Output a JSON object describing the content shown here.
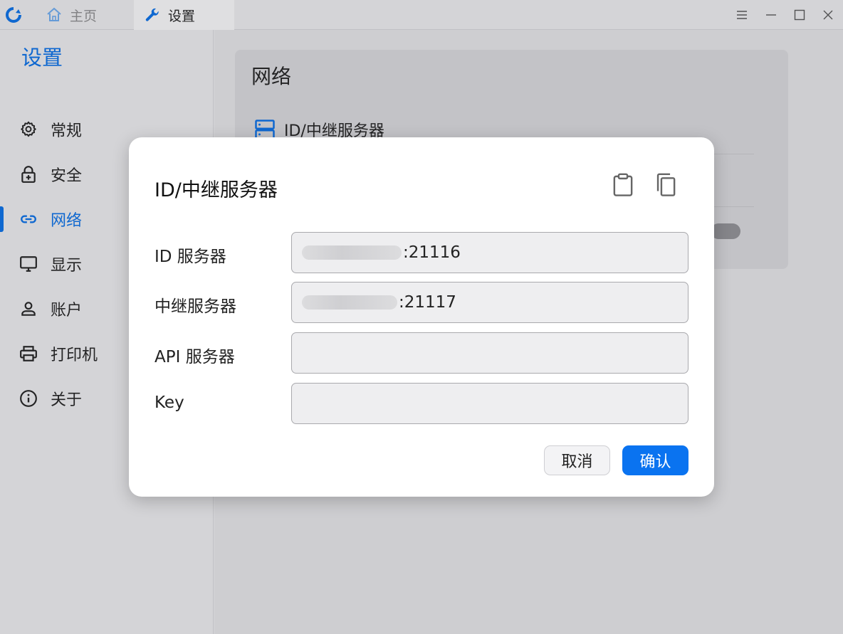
{
  "titlebar": {
    "tabs": [
      {
        "label": "主页",
        "icon": "home-icon"
      },
      {
        "label": "设置",
        "icon": "wrench-icon"
      }
    ],
    "controls": [
      "menu-icon",
      "minimize-icon",
      "maximize-icon",
      "close-icon"
    ]
  },
  "sidebar": {
    "title": "设置",
    "items": [
      {
        "label": "常规",
        "icon": "gear-icon"
      },
      {
        "label": "安全",
        "icon": "lock-icon"
      },
      {
        "label": "网络",
        "icon": "link-icon",
        "active": true
      },
      {
        "label": "显示",
        "icon": "monitor-icon"
      },
      {
        "label": "账户",
        "icon": "person-icon"
      },
      {
        "label": "打印机",
        "icon": "printer-icon"
      },
      {
        "label": "关于",
        "icon": "info-icon"
      }
    ]
  },
  "main": {
    "card": {
      "title": "网络",
      "rows": [
        {
          "label": "ID/中继服务器",
          "icon": "server-icon"
        }
      ]
    }
  },
  "dialog": {
    "title": "ID/中继服务器",
    "actions": [
      "clipboard-icon",
      "copy-icon"
    ],
    "fields": [
      {
        "label": "ID 服务器",
        "value_visible": ":21116"
      },
      {
        "label": "中继服务器",
        "value_visible": ":21117"
      },
      {
        "label": "API 服务器",
        "value_visible": ""
      },
      {
        "label": "Key",
        "value_visible": ""
      }
    ],
    "cancel_label": "取消",
    "confirm_label": "确认"
  },
  "colors": {
    "accent": "#0b6ee0",
    "confirm_button": "#0a73f0",
    "background": "#e6e6e8"
  }
}
